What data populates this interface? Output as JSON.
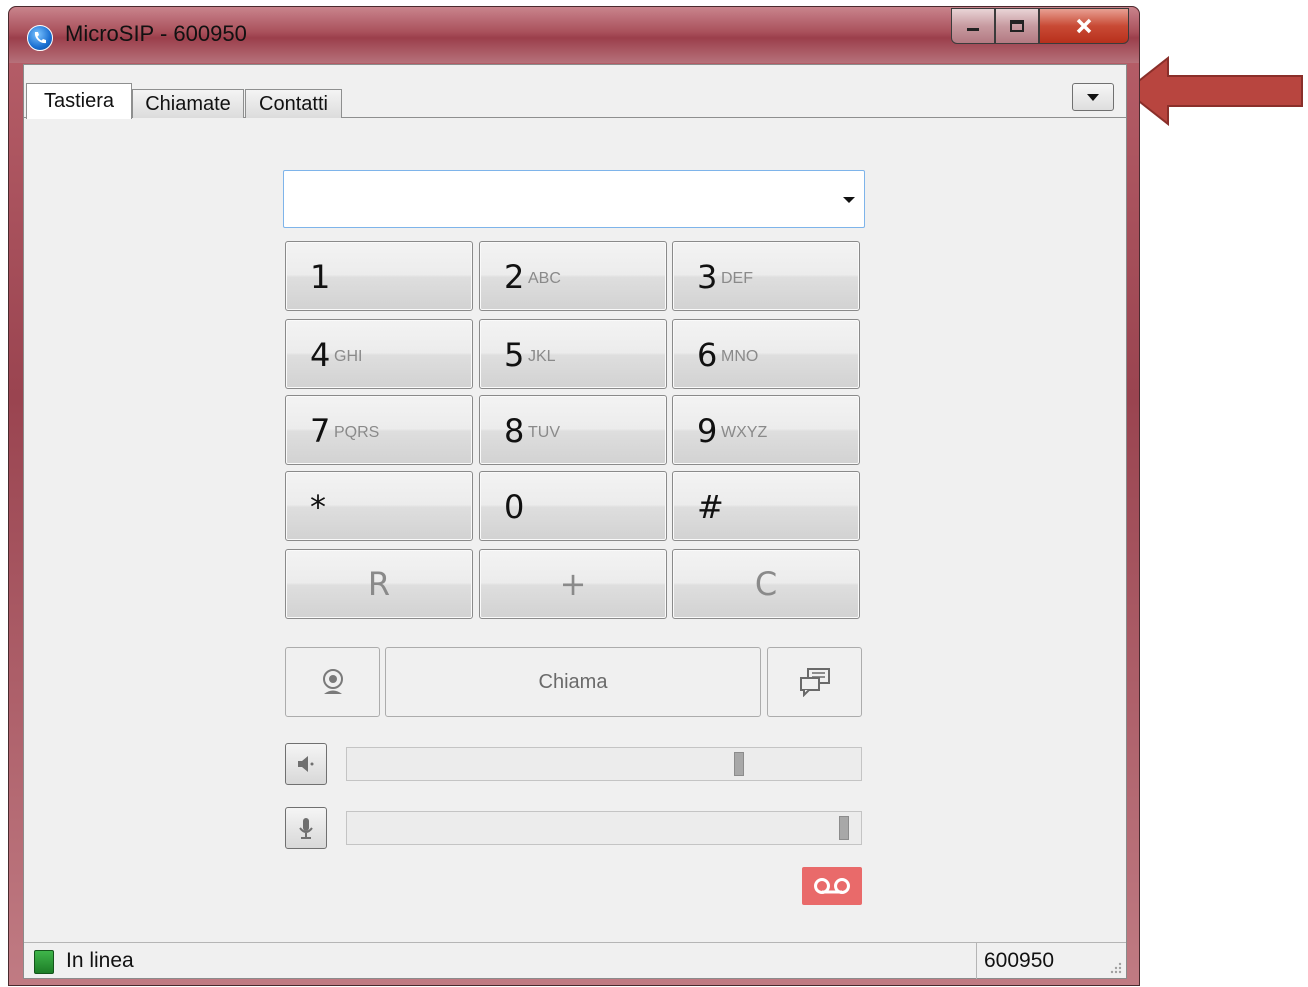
{
  "window": {
    "title": "MicroSIP - 600950"
  },
  "tabs": [
    {
      "label": "Tastiera",
      "active": true
    },
    {
      "label": "Chiamate",
      "active": false
    },
    {
      "label": "Contatti",
      "active": false
    }
  ],
  "menu_button_icon": "menu-dropdown-icon",
  "dial_input": {
    "value": "",
    "placeholder": ""
  },
  "keypad": [
    {
      "digit": "1",
      "letters": ""
    },
    {
      "digit": "2",
      "letters": "ABC"
    },
    {
      "digit": "3",
      "letters": "DEF"
    },
    {
      "digit": "4",
      "letters": "GHI"
    },
    {
      "digit": "5",
      "letters": "JKL"
    },
    {
      "digit": "6",
      "letters": "MNO"
    },
    {
      "digit": "7",
      "letters": "PQRS"
    },
    {
      "digit": "8",
      "letters": "TUV"
    },
    {
      "digit": "9",
      "letters": "WXYZ"
    },
    {
      "digit": "*",
      "letters": ""
    },
    {
      "digit": "0",
      "letters": ""
    },
    {
      "digit": "#",
      "letters": ""
    }
  ],
  "special_keys": {
    "redial": "R",
    "plus": "+",
    "clear": "C"
  },
  "actions": {
    "call_label": "Chiama"
  },
  "volume": {
    "speaker_level": 0.77,
    "microphone_level": 0.98
  },
  "status": {
    "text": "In linea",
    "extension": "600950"
  },
  "colors": {
    "voicemail": "#e96a6a",
    "status_online": "#2e9b3a",
    "arrow": "#b8453f"
  }
}
